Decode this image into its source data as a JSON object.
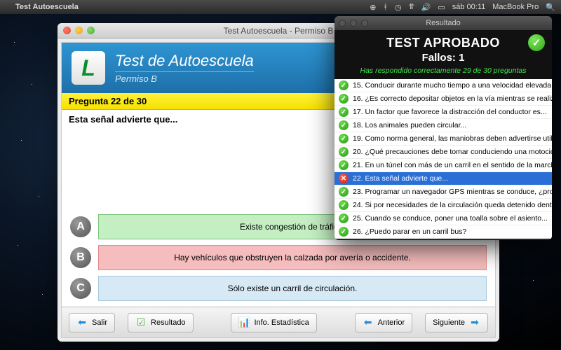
{
  "menubar": {
    "app_name": "Test Autoescuela",
    "clock": "sáb 00:11",
    "device": "MacBook Pro"
  },
  "main_window": {
    "title": "Test Autoescuela - Permiso B",
    "header_title": "Test de Autoescuela",
    "header_subtitle": "Permiso B",
    "logo_letter": "L",
    "question_counter": "Pregunta 22 de 30",
    "question_text": "Esta señal advierte que...",
    "answers": [
      {
        "letter": "A",
        "text": "Existe congestión de tráfico.",
        "state": "correct"
      },
      {
        "letter": "B",
        "text": "Hay vehículos que obstruyen la calzada por avería o accidente.",
        "state": "wrong"
      },
      {
        "letter": "C",
        "text": "Sólo existe un carril de circulación.",
        "state": "neutral"
      }
    ],
    "toolbar": {
      "exit": "Salir",
      "result": "Resultado",
      "stats": "Info. Estadística",
      "prev": "Anterior",
      "next": "Siguiente"
    }
  },
  "result_window": {
    "title": "Resultado",
    "heading": "TEST APROBADO",
    "fails_label": "Fallos: 1",
    "subtitle": "Has respondido correctamente 29 de 30 preguntas",
    "rows": [
      {
        "n": "15",
        "text": "Conducir durante mucho tiempo a una velocidad elevada...",
        "ok": true
      },
      {
        "n": "16",
        "text": "¿Es correcto depositar objetos en la vía mientras se realizan operaciones",
        "ok": true
      },
      {
        "n": "17",
        "text": "Un factor que favorece la distracción del conductor es...",
        "ok": true
      },
      {
        "n": "18",
        "text": "Los animales pueden circular...",
        "ok": true
      },
      {
        "n": "19",
        "text": "Como norma general, las maniobras deben advertirse utilizando...",
        "ok": true
      },
      {
        "n": "20",
        "text": "¿Qué precauciones debe tomar conduciendo una motocicleta si empieza",
        "ok": true
      },
      {
        "n": "21",
        "text": "En un túnel con más de un carril en el sentido de la marcha, ¿está permit",
        "ok": true
      },
      {
        "n": "22",
        "text": "Esta señal advierte que...",
        "ok": false,
        "selected": true
      },
      {
        "n": "23",
        "text": "Programar un navegador GPS mientras se conduce, ¿provoca distracciones",
        "ok": true
      },
      {
        "n": "24",
        "text": "Si por necesidades de la circulación queda detenido dentro de un paso in",
        "ok": true
      },
      {
        "n": "25",
        "text": "Cuando se conduce, poner una toalla sobre el asiento...",
        "ok": true
      },
      {
        "n": "26",
        "text": "¿Puedo parar en un carril bus?",
        "ok": true
      }
    ]
  }
}
